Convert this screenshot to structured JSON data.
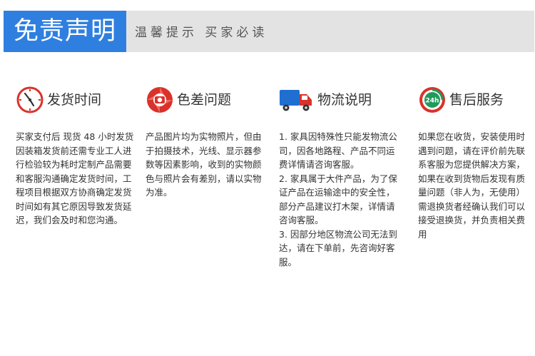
{
  "banner": {
    "title": "免责声明",
    "subtitle": "温馨提示  买家必读"
  },
  "columns": [
    {
      "title": "发货时间",
      "icon": "clock-icon",
      "paragraphs": [
        "买家支付后 现货 48 小时发货 因装箱发货前还需专业工人进行检验较为耗时定制产品需要和客服沟通确定发货时间，工程项目根据双方协商确定发货时间如有其它原因导致发货延迟，我们会及时和您沟通。"
      ]
    },
    {
      "title": "色差问题",
      "icon": "camera-lens-icon",
      "paragraphs": [
        "产品图片均为实物照片，但由于拍摄技术，光线、显示器参数等因素影响，收到的实物颜色与照片会有差别，请以实物为准。"
      ]
    },
    {
      "title": "物流说明",
      "icon": "truck-icon",
      "paragraphs": [
        "1. 家具因特殊性只能发物流公司，因各地路程、产品不同运费详情请咨询客服。",
        "2. 家具属于大件产品，为了保证产品在运输途中的安全性，部分产品建议打木架，详情请咨询客服。",
        "3. 因部分地区物流公司无法到达，请在下单前，先咨询好客服。"
      ]
    },
    {
      "title": "售后服务",
      "icon": "24h-service-icon",
      "badge": "24h",
      "paragraphs": [
        "如果您在收货，安装使用时遇到问题，请在评价前先联系客服为您提供解决方案，如果在收到货物后发现有质量问题（非人为，无使用）需退换货者经确认我们可以接受退换货，并负责相关费用"
      ]
    }
  ],
  "colors": {
    "accent": "#2f7fe0",
    "banner_bg": "#e3e3e3",
    "icon_red": "#d9322b",
    "icon_blue": "#1f6fd1",
    "icon_green": "#1f9a5a"
  }
}
